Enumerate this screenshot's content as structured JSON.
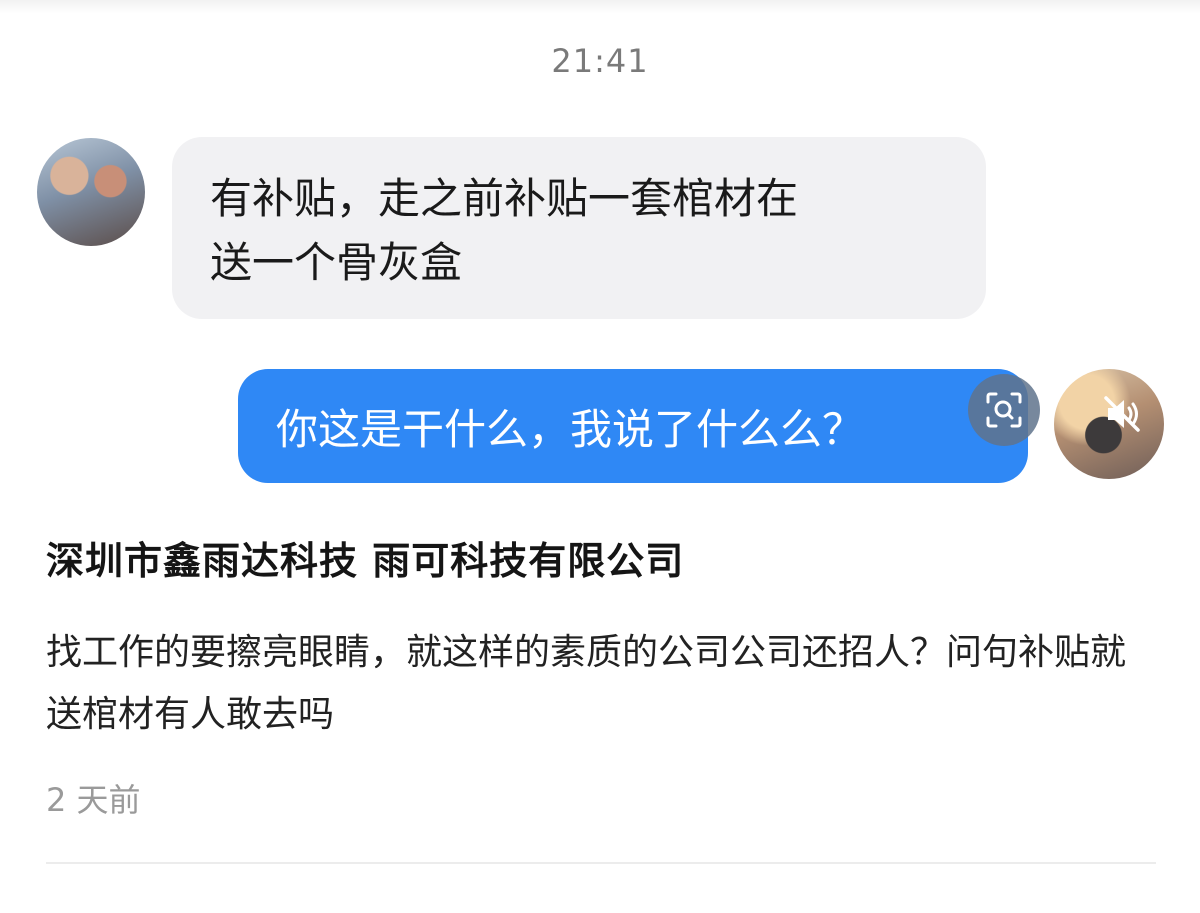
{
  "chat": {
    "timestamp": "21:41",
    "incoming": {
      "text": "有补贴，走之前补贴一套棺材在\n送一个骨灰盒"
    },
    "outgoing": {
      "text": "你这是干什么，我说了什么么？"
    },
    "icons": {
      "scan": "scan-search-icon",
      "mute": "speaker-muted-icon"
    },
    "colors": {
      "outgoing_bubble": "#2f88f5",
      "incoming_bubble": "#f1f1f3"
    }
  },
  "post": {
    "title": "深圳市鑫雨达科技 雨可科技有限公司",
    "body": "找工作的要擦亮眼睛，就这样的素质的公司公司还招人？问句补贴就送棺材有人敢去吗",
    "time": "2 天前"
  }
}
